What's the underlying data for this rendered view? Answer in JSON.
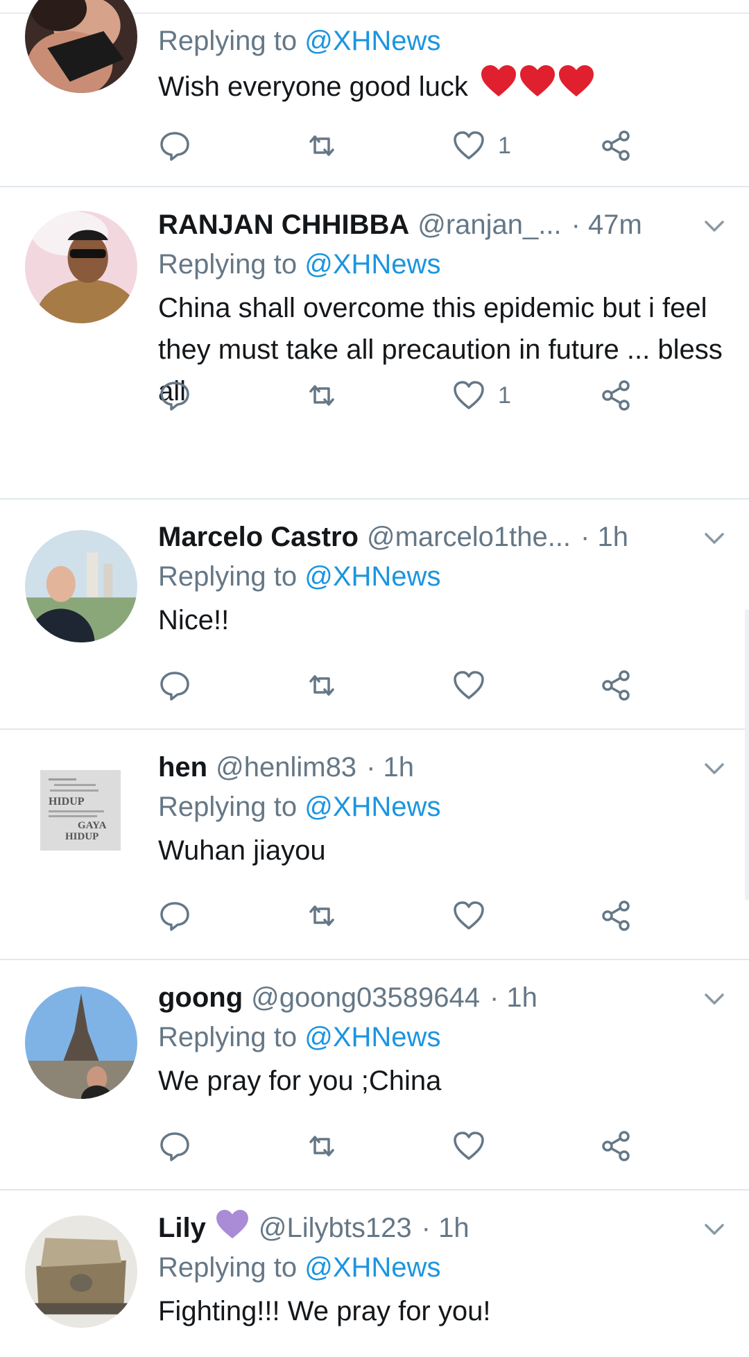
{
  "tweets": [
    {
      "name": "",
      "handle": "",
      "time": "",
      "replying_prefix": "Replying to",
      "replying_to": "@XHNews",
      "text": "Wish everyone good luck",
      "emoji": [
        "red-heart",
        "red-heart",
        "red-heart"
      ],
      "likes": "1"
    },
    {
      "name": "RANJAN CHHIBBA",
      "handle": "@ranjan_...",
      "time": "· 47m",
      "replying_prefix": "Replying to",
      "replying_to": "@XHNews",
      "text": "China shall overcome this epidemic but i feel they must take all precaution in future ... bless all",
      "likes": "1"
    },
    {
      "name": "Marcelo Castro",
      "handle": "@marcelo1the...",
      "time": "· 1h",
      "replying_prefix": "Replying to",
      "replying_to": "@XHNews",
      "text": "Nice!!",
      "likes": ""
    },
    {
      "name": "hen",
      "handle": "@henlim83",
      "time": "· 1h",
      "replying_prefix": "Replying to",
      "replying_to": "@XHNews",
      "text": "Wuhan jiayou",
      "likes": "",
      "avatar_text": [
        "HIDUP",
        "GAYA",
        "HIDUP"
      ]
    },
    {
      "name": "goong",
      "handle": "@goong03589644",
      "time": "· 1h",
      "replying_prefix": "Replying to",
      "replying_to": "@XHNews",
      "text": "We pray for you ;China",
      "likes": ""
    },
    {
      "name": "Lily",
      "name_badge": "purple-heart",
      "handle": "@Lilybts123",
      "time": "· 1h",
      "replying_prefix": "Replying to",
      "replying_to": "@XHNews",
      "text": "Fighting!!! We pray for you!",
      "likes": ""
    }
  ],
  "colors": {
    "link": "#1b95e0",
    "secondary_text": "#657786",
    "divider": "#e1e8ed",
    "heart_red": "#e0202e",
    "heart_purple": "#a98bd6"
  },
  "icons": [
    "reply-icon",
    "retweet-icon",
    "like-icon",
    "share-icon",
    "chevron-down-icon"
  ]
}
